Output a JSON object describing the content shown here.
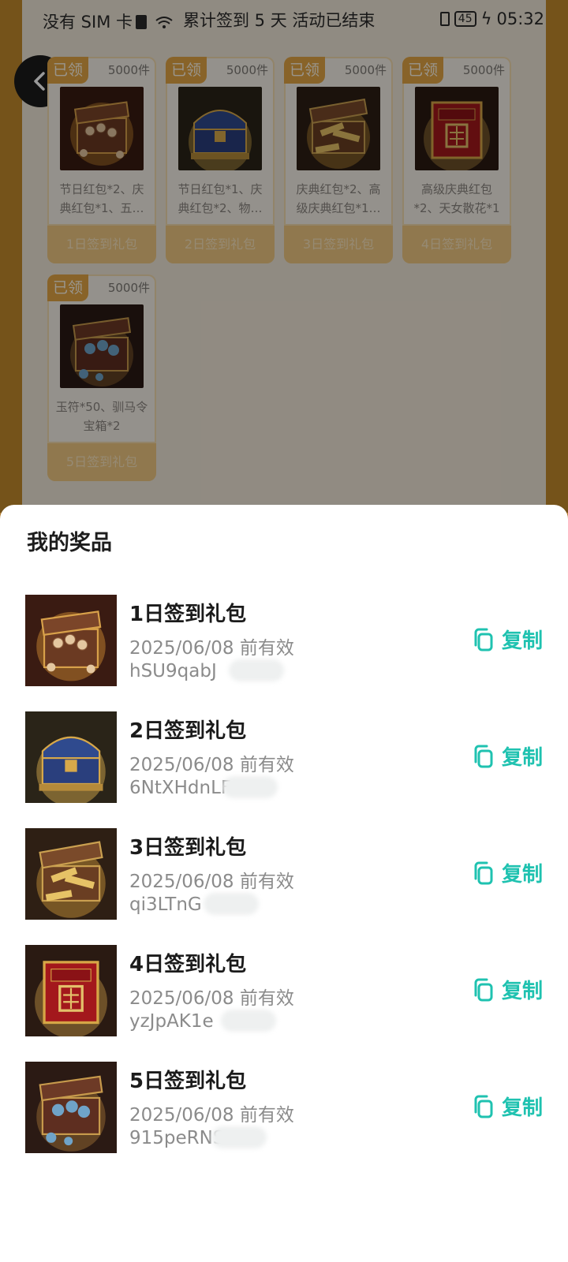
{
  "status_bar": {
    "left": "没有 SIM 卡",
    "mid": "累计签到 5 天   活动已结束",
    "battery": "45",
    "time": "05:32"
  },
  "gift_cards": [
    {
      "tag": "已领",
      "count": "5000件",
      "desc": "节日红包*2、庆典红包*1、五…",
      "button": "1日签到礼包"
    },
    {
      "tag": "已领",
      "count": "5000件",
      "desc": "节日红包*1、庆典红包*2、物…",
      "button": "2日签到礼包"
    },
    {
      "tag": "已领",
      "count": "5000件",
      "desc": "庆典红包*2、高级庆典红包*1…",
      "button": "3日签到礼包"
    },
    {
      "tag": "已领",
      "count": "5000件",
      "desc": "高级庆典红包*2、天女散花*1",
      "button": "4日签到礼包"
    },
    {
      "tag": "已领",
      "count": "5000件",
      "desc": "玉符*50、驯马令宝箱*2",
      "button": "5日签到礼包"
    }
  ],
  "sheet": {
    "title": "我的奖品",
    "copy_label": "复制",
    "items": [
      {
        "name": "1日签到礼包",
        "valid": "2025/06/08 前有效",
        "code": "hSU9qabJ"
      },
      {
        "name": "2日签到礼包",
        "valid": "2025/06/08 前有效",
        "code": "6NtXHdnLF"
      },
      {
        "name": "3日签到礼包",
        "valid": "2025/06/08 前有效",
        "code": "qi3LTnG"
      },
      {
        "name": "4日签到礼包",
        "valid": "2025/06/08 前有效",
        "code": "yzJpAK1e"
      },
      {
        "name": "5日签到礼包",
        "valid": "2025/06/08 前有效",
        "code": "915peRNS"
      }
    ]
  },
  "colors": {
    "accent": "#1fc2b0",
    "tag": "#e3a645",
    "card_button": "#f0c982"
  },
  "icons": [
    "back-arrow-icon",
    "copy-icon",
    "sim-alert-icon",
    "wifi-icon",
    "vibrate-icon",
    "battery-icon",
    "charging-icon"
  ]
}
